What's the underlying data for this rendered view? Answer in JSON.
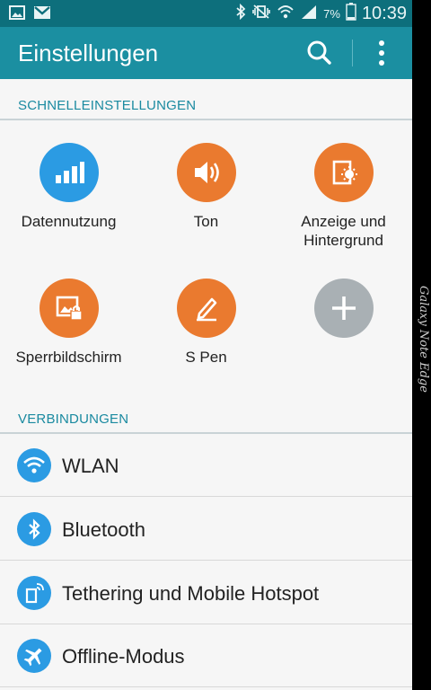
{
  "status_bar": {
    "time": "10:39",
    "battery_percent": "7%",
    "left_icons": [
      "image-notification-icon",
      "mail-notification-icon"
    ],
    "right_icons": [
      "bluetooth-icon",
      "vibrate-mute-icon",
      "wifi-icon",
      "signal-icon",
      "battery-icon"
    ]
  },
  "action_bar": {
    "title": "Einstellungen",
    "actions": [
      "search-icon",
      "overflow-menu-icon"
    ]
  },
  "quick_settings": {
    "header": "SCHNELLEINSTELLUNGEN",
    "tiles": [
      {
        "label": "Datennutzung",
        "icon": "data-usage-icon",
        "color": "#2b9be3"
      },
      {
        "label": "Ton",
        "icon": "sound-icon",
        "color": "#ea7a2f"
      },
      {
        "label": "Anzeige und\nHintergrund",
        "icon": "display-icon",
        "color": "#ea7a2f"
      },
      {
        "label": "Sperrbildschirm",
        "icon": "lock-screen-icon",
        "color": "#ea7a2f"
      },
      {
        "label": "S Pen",
        "icon": "s-pen-icon",
        "color": "#ea7a2f"
      },
      {
        "label": "",
        "icon": "add-icon",
        "color": "#a9b0b4"
      }
    ]
  },
  "connections": {
    "header": "VERBINDUNGEN",
    "items": [
      {
        "label": "WLAN",
        "icon": "wifi-icon"
      },
      {
        "label": "Bluetooth",
        "icon": "bluetooth-icon"
      },
      {
        "label": "Tethering und Mobile Hotspot",
        "icon": "tethering-icon"
      },
      {
        "label": "Offline-Modus",
        "icon": "airplane-icon"
      }
    ]
  },
  "edge_panel": {
    "text": "Galaxy Note Edge"
  },
  "colors": {
    "status_bar": "#0d6f7c",
    "action_bar": "#1b8fa1",
    "accent_text": "#1a8aa0",
    "blue_icon": "#2b9be3",
    "orange_icon": "#ea7a2f",
    "grey_icon": "#a9b0b4"
  }
}
